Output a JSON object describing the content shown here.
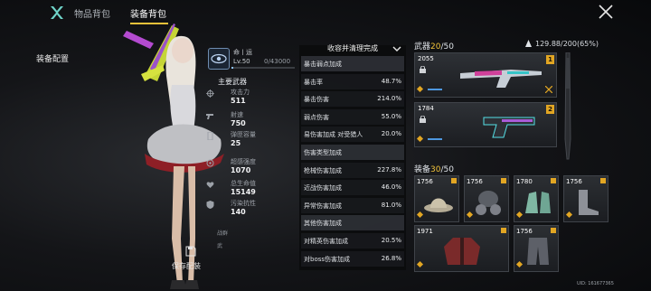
{
  "header": {
    "tabs": [
      {
        "label": "物品背包",
        "active": false
      },
      {
        "label": "装备背包",
        "active": true
      }
    ]
  },
  "sidebar": {
    "title": "装备配置",
    "save_label": "保存配装"
  },
  "character": {
    "name": "命丨运",
    "level": "Lv.50",
    "exp": "0/43000",
    "exp_progress": 0.0,
    "section_title": "主要武器",
    "stats": [
      {
        "label": "攻击力",
        "value": "511",
        "icon": "crosshair-icon"
      },
      {
        "label": "射速",
        "value": "750",
        "icon": "gun-icon"
      },
      {
        "label": "弹匣容量",
        "value": "25",
        "icon": "magazine-icon"
      },
      {
        "label": "超感强度",
        "value": "1070",
        "icon": "brain-icon"
      },
      {
        "label": "总生命值",
        "value": "15149",
        "icon": "heart-icon"
      },
      {
        "label": "污染抗性",
        "value": "140",
        "icon": "shield-icon"
      }
    ],
    "extra_labels": [
      "战群",
      "武"
    ]
  },
  "attributes": {
    "title": "收容并清理完成",
    "rows": [
      {
        "kind": "head",
        "label": "暴击弱点加成",
        "value": ""
      },
      {
        "kind": "stat",
        "label": "暴击率",
        "value": "48.7%"
      },
      {
        "kind": "stat",
        "label": "暴击伤害",
        "value": "214.0%"
      },
      {
        "kind": "stat",
        "label": "弱点伤害",
        "value": "55.0%"
      },
      {
        "kind": "stat",
        "label": "易伤害加成  对受猎人",
        "value": "20.0%"
      },
      {
        "kind": "head",
        "label": "伤害类型加成",
        "value": ""
      },
      {
        "kind": "stat",
        "label": "枪械伤害加成",
        "value": "227.8%"
      },
      {
        "kind": "stat",
        "label": "近战伤害加成",
        "value": "46.0%"
      },
      {
        "kind": "stat",
        "label": "异常伤害加成",
        "value": "81.0%"
      },
      {
        "kind": "head",
        "label": "其他伤害加成",
        "value": ""
      },
      {
        "kind": "stat",
        "label": "对精英伤害加成",
        "value": "20.5%"
      },
      {
        "kind": "stat",
        "label": "对boss伤害加成",
        "value": "26.8%"
      }
    ]
  },
  "weapons": {
    "title": "武器",
    "count": "20",
    "capacity": "/50",
    "weight": "129.88/200(65%)",
    "items": [
      {
        "power": "2055",
        "slot": "1",
        "icon": "rifle-icon"
      },
      {
        "power": "1784",
        "slot": "2",
        "icon": "pistol-icon"
      }
    ]
  },
  "gear": {
    "title": "装备",
    "count": "30",
    "capacity": "/50",
    "items": [
      {
        "power": "1756",
        "icon": "hat-icon"
      },
      {
        "power": "1756",
        "icon": "gas-mask-icon"
      },
      {
        "power": "1780",
        "icon": "gloves-icon"
      },
      {
        "power": "1756",
        "icon": "boots-icon"
      },
      {
        "power": "1971",
        "icon": "jacket-icon"
      },
      {
        "power": "1756",
        "icon": "pants-icon"
      }
    ]
  },
  "footer": {
    "uid": "UID: 161677365"
  },
  "colors": {
    "accent": "#f0c23a",
    "rarity": "#e2a623",
    "exp_blue": "#8fc3ff"
  }
}
